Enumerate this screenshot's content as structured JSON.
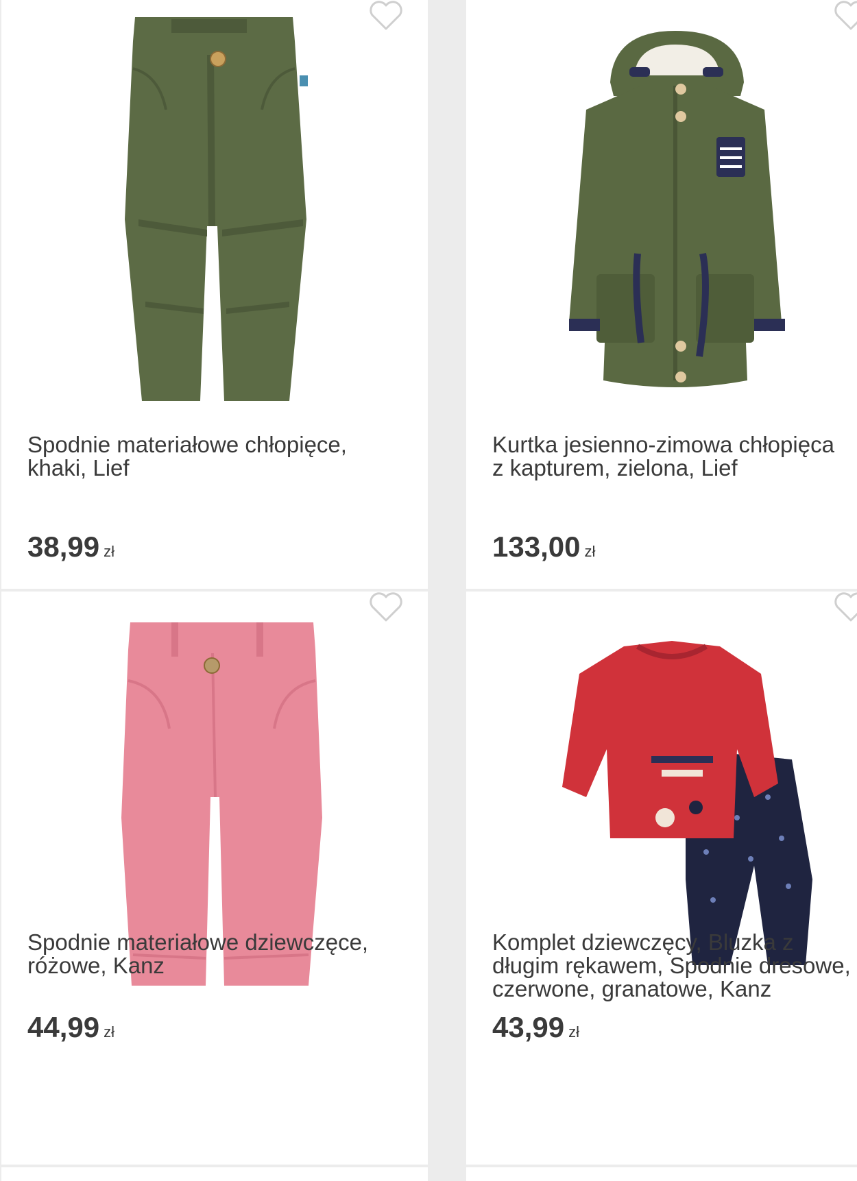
{
  "products": [
    {
      "title": "Spodnie materiałowe chłopięce,\nkhaki, Lief",
      "price": "38,99",
      "currency": "zł",
      "image_icon": "khaki-pants-image",
      "favorite_icon": "heart-outline-icon",
      "colors": {
        "main": "#5c6b45",
        "shade": "#4d5a3a"
      }
    },
    {
      "title": "Kurtka jesienno-zimowa chłopięca\nz kapturem, zielona, Lief",
      "price": "133,00",
      "currency": "zł",
      "image_icon": "green-jacket-image",
      "favorite_icon": "heart-outline-icon",
      "colors": {
        "main": "#5a6942",
        "trim": "#2b2f55"
      }
    },
    {
      "title": "Spodnie materiałowe dziewczęce,\nróżowe, Kanz",
      "price": "44,99",
      "currency": "zł",
      "image_icon": "pink-pants-image",
      "favorite_icon": "heart-outline-icon",
      "colors": {
        "main": "#e88a9a",
        "shade": "#d87688"
      }
    },
    {
      "title": "Komplet dziewczęcy, Bluzka z\ndługim rękawem, Spodnie dresowe,\nczerwone, granatowe, Kanz",
      "price": "43,99",
      "currency": "zł",
      "image_icon": "red-top-navy-pants-image",
      "favorite_icon": "heart-outline-icon",
      "colors": {
        "top": "#d0323a",
        "pants": "#1f2440"
      }
    }
  ]
}
